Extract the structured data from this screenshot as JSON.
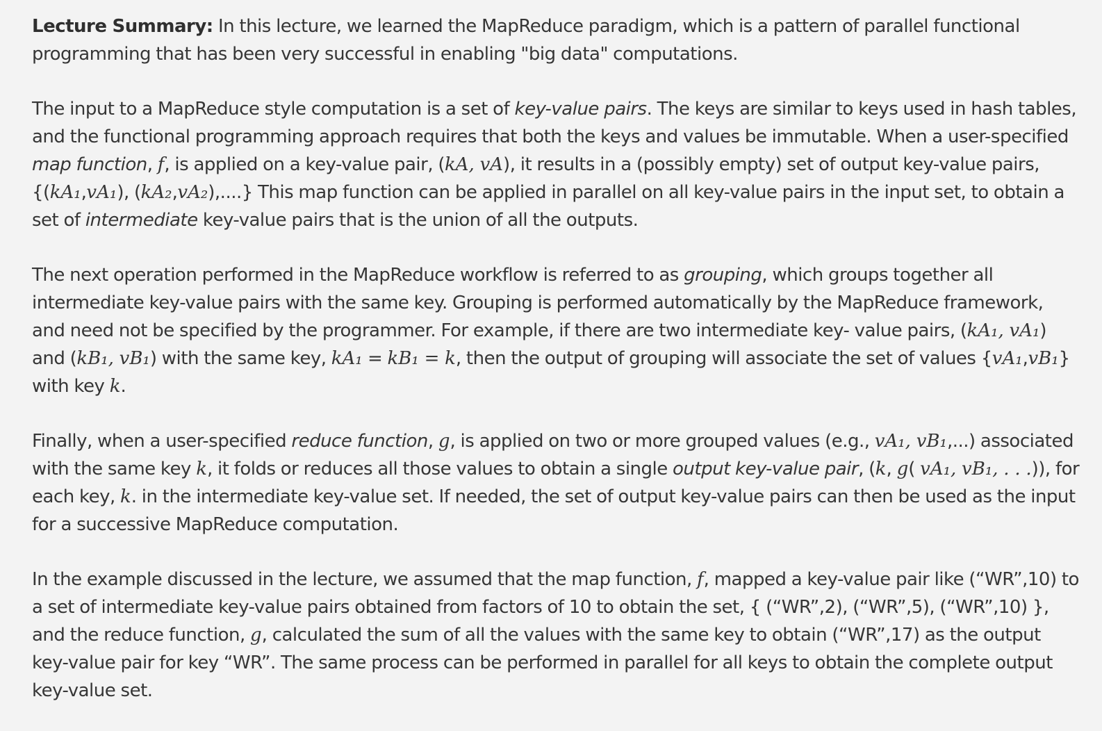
{
  "summary": {
    "label": "Lecture Summary:",
    "text": " In this lecture, we learned the MapReduce paradigm, which is a pattern of parallel functional programming that has been very successful in enabling \"big data\" computations."
  },
  "p2": {
    "t1": "The input to a MapReduce style computation is a set of ",
    "em1": "key-value pairs",
    "t2": ". The keys are similar to keys used in hash tables, and the functional programming approach requires that both the keys and values be immutable. When a user-specified ",
    "em2": "map function",
    "t3": ", ",
    "m1": "f",
    "t4": ", is applied on a key-value pair, (",
    "m2": "kA, vA",
    "t5": "), it results in a (possibly empty) set of output key-value pairs, {(",
    "m3": "kA₁",
    "t6": ",",
    "m4": "vA₁",
    "t7": "), (",
    "m5": "kA₂",
    "t8": ",",
    "m6": "vA₂",
    "t9": "),....} This map function can be applied in parallel on all key-value pairs in the input set, to obtain a set of ",
    "em3": "intermediate",
    "t10": " key-value pairs that is the union of all the outputs."
  },
  "p3": {
    "t1": "The next operation performed in the MapReduce workflow is referred to as ",
    "em1": "grouping",
    "t2": ", which groups together all intermediate key-value pairs with the same key. Grouping is performed automatically by the MapReduce framework, and need not be specified by the programmer. For example, if there are two intermediate key- value pairs, (",
    "m1": "kA₁, vA₁",
    "t3": ") and (",
    "m2": "kB₁, vB₁",
    "t4": ") with the same key, ",
    "m3": "kA₁",
    "t5": " = ",
    "m4": "kB₁ = k",
    "t6": ", then the output of grouping will associate the set of values {",
    "m5": "vA₁",
    "t7": ",",
    "m6": "vB₁",
    "t8": "} with key ",
    "m7": "k",
    "t9": "."
  },
  "p4": {
    "t1": "Finally, when a user-specified ",
    "em1": "reduce function",
    "t2": ", ",
    "m1": "g",
    "t3": ", is applied on two or more grouped values (e.g., ",
    "m2": "vA₁, vB₁",
    "t4": ",...) associated with the same key ",
    "m3": "k",
    "t5": ", it folds or reduces all those values to obtain a single ",
    "em2": "output key-value pair",
    "t6": ", (",
    "m4": "k",
    "t7": ", ",
    "m5": "g",
    "t8": "( ",
    "m6": "vA₁, vB₁, . . .",
    "t9": ")), for each key, ",
    "m7": "k",
    "t10": ". in the intermediate key-value set. If needed, the set of output key-value pairs can then be used as the input for a successive MapReduce computation."
  },
  "p5": {
    "t1": "In the example discussed in the lecture, we assumed that the map function, ",
    "m1": "f",
    "t2": ", mapped a key-value pair like (“WR”,10) to a set of intermediate key-value pairs obtained from factors of 10 to obtain the set, { (“WR”,2), (“WR”,5), (“WR”,10) }, and the reduce function, ",
    "m2": "g",
    "t3": ", calculated the sum of all the values with the same key to obtain (“WR”,17) as the output key-value pair for key “WR”. The same process can be performed in parallel for all keys to obtain the complete output key-value set."
  }
}
